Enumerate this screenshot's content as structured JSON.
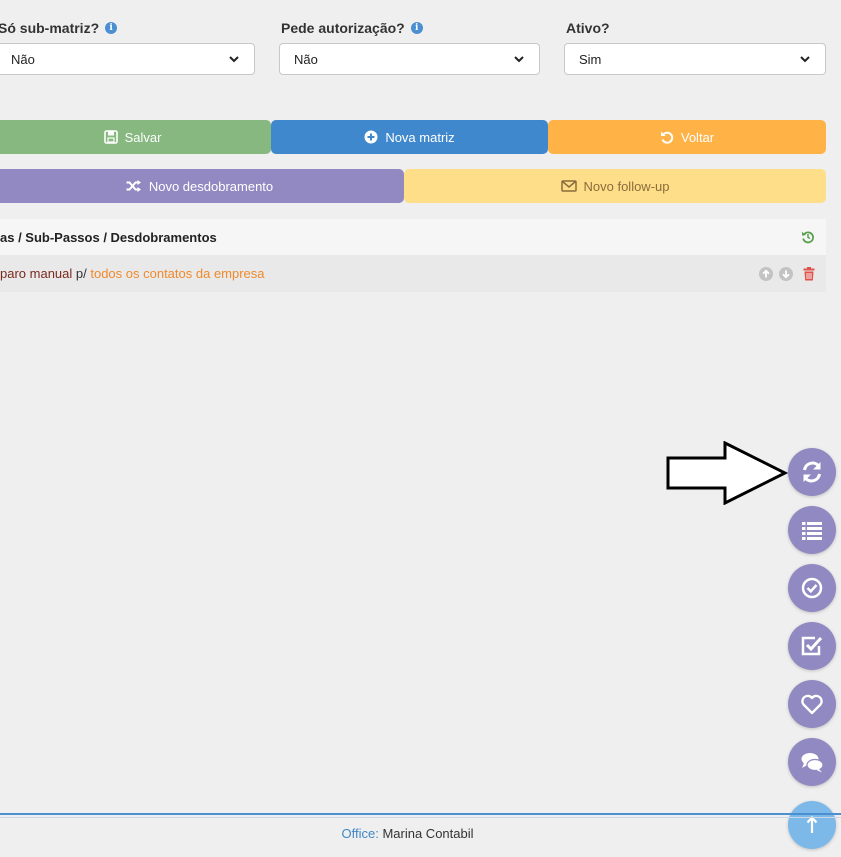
{
  "form": {
    "sub_matriz": {
      "label": "Só sub-matriz?",
      "value": "Não"
    },
    "pede_autorizacao": {
      "label": "Pede autorização?",
      "value": "Não"
    },
    "ativo": {
      "label": "Ativo?",
      "value": "Sim"
    }
  },
  "buttons": {
    "salvar": "Salvar",
    "nova_matriz": "Nova matriz",
    "voltar": "Voltar",
    "novo_desdobramento": "Novo desdobramento",
    "novo_follow_up": "Novo follow-up"
  },
  "panel": {
    "header": "as / Sub-Passos / Desdobramentos",
    "row": {
      "part1": "paro manual",
      "part2": " p/ ",
      "part3": "todos os contatos da empresa"
    }
  },
  "footer": {
    "label": "Office:",
    "value": " Marina Contabil"
  },
  "colors": {
    "salvar": "#86b880",
    "nova_matriz": "#3f88cd",
    "voltar": "#ffb347",
    "novo_desdobramento": "#9389c2",
    "novo_follow_up": "#ffde8a",
    "fab": "#9189c2",
    "accent_orange": "#f08a2c",
    "dark_red": "#7a2a1e"
  },
  "icons": {
    "fabs": [
      "sync-icon",
      "list-icon",
      "check-circle-icon",
      "checkbox-icon",
      "heart-icon",
      "comments-icon",
      "arrow-up-icon"
    ]
  }
}
